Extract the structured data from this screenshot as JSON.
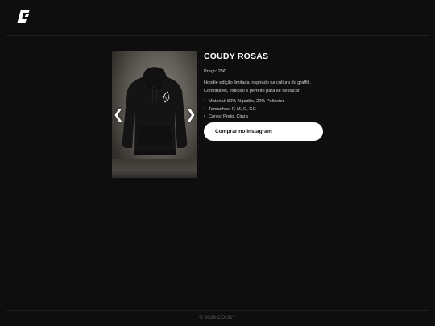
{
  "header": {
    "logo_icon": "brand-c-logo-icon"
  },
  "gallery": {
    "image": "black-hoodie-product-photo",
    "prev_label": "❮",
    "next_label": "❯"
  },
  "product": {
    "title": "COUDY ROSAS",
    "price": "Preço: 25€",
    "description": "Hoodie edição limitada inspirado na cultura do graffiti. Confortável, estiloso e perfeito para se destacar.",
    "specs": [
      "Material: 80% Algodão, 20% Poliéster",
      "Tamanhos: P, M, G, GG",
      "Cores: Preto, Cinza"
    ],
    "buy_label": "Comprar no Instagram"
  },
  "footer": {
    "copyright": "© 2026 COUDY"
  },
  "colors": {
    "background": "#0e0e0e",
    "button": "#ffffff",
    "button_text": "#111111"
  }
}
